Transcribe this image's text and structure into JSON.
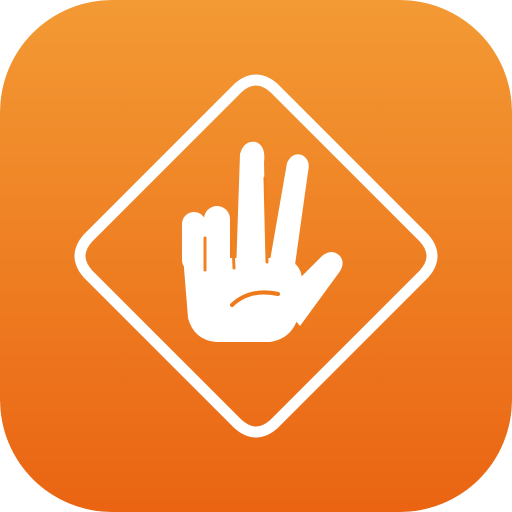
{
  "icon": {
    "name": "hand-warning-sign-icon",
    "colors": {
      "gradient_top": "#F39A34",
      "gradient_bottom": "#EA6412",
      "glyph": "#FFFFFF"
    }
  }
}
